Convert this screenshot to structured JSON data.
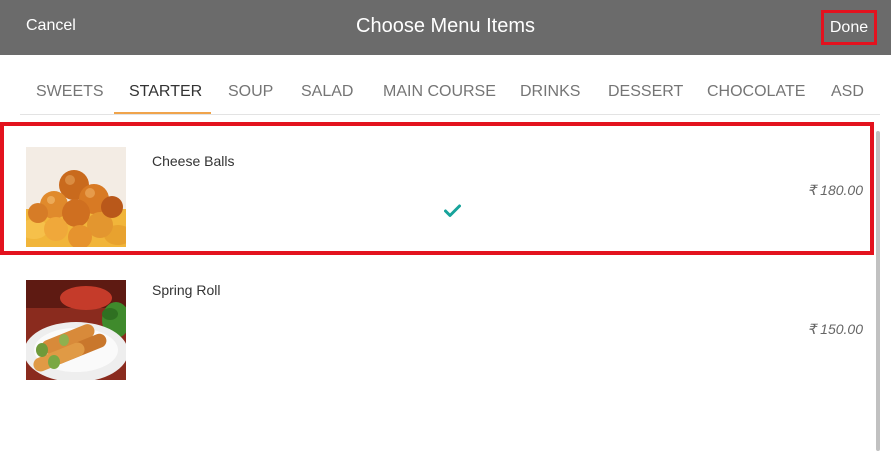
{
  "header": {
    "cancel_label": "Cancel",
    "title": "Choose Menu Items",
    "done_label": "Done"
  },
  "tabs": [
    {
      "label": "SWEETS"
    },
    {
      "label": "STARTER",
      "active": true
    },
    {
      "label": "SOUP"
    },
    {
      "label": "SALAD"
    },
    {
      "label": "MAIN COURSE"
    },
    {
      "label": "DRINKS"
    },
    {
      "label": "DESSERT"
    },
    {
      "label": "CHOCOLATE"
    },
    {
      "label": "ASD"
    }
  ],
  "items": [
    {
      "name": "Cheese Balls",
      "price": "₹ 180.00",
      "selected": true
    },
    {
      "name": "Spring Roll",
      "price": "₹ 150.00",
      "selected": false
    }
  ],
  "colors": {
    "header_bg": "#6b6b6b",
    "highlight": "#e3121e",
    "active_tab_indicator": "#f0a44b",
    "check": "#17a39b"
  }
}
